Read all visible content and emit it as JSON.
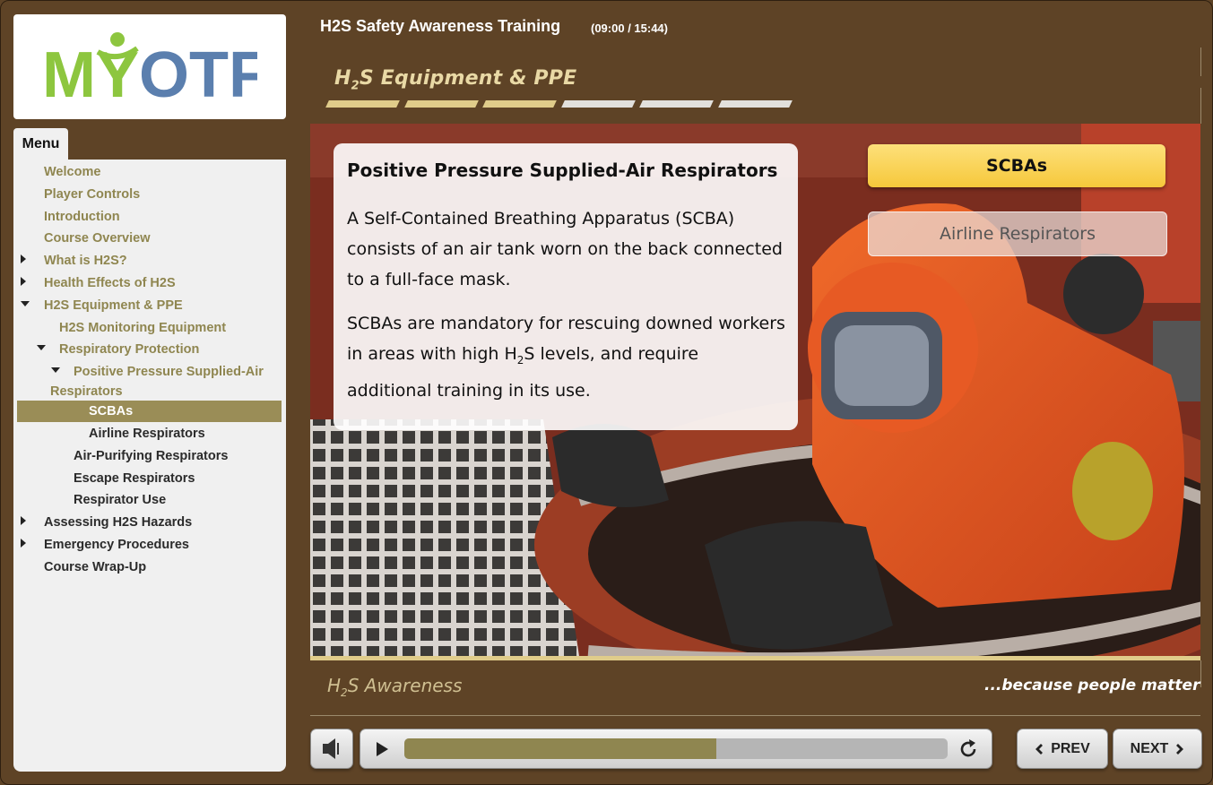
{
  "header": {
    "course_title": "H2S Safety Awareness Training",
    "time": "(09:00 / 15:44)",
    "section_title_prefix": "H",
    "section_title_sub": "2",
    "section_title_rest": "S Equipment & PPE",
    "section_progress": {
      "completed": 3,
      "total": 6
    }
  },
  "logo": {
    "text_my": "MY",
    "text_otf": "OTF",
    "colors": {
      "my": "#8dc63f",
      "otf": "#5b7fae"
    }
  },
  "menu": {
    "tab_label": "Menu",
    "items": [
      {
        "label": "Welcome",
        "state": "done",
        "toggle": "none",
        "indent": 0
      },
      {
        "label": "Player Controls",
        "state": "done",
        "toggle": "none",
        "indent": 0
      },
      {
        "label": "Introduction",
        "state": "done",
        "toggle": "none",
        "indent": 0
      },
      {
        "label": "Course Overview",
        "state": "done",
        "toggle": "none",
        "indent": 0
      },
      {
        "label": "What is H2S?",
        "state": "done",
        "toggle": "collapsed",
        "indent": 0
      },
      {
        "label": "Health Effects of H2S",
        "state": "done",
        "toggle": "collapsed",
        "indent": 0
      },
      {
        "label": "H2S Equipment & PPE",
        "state": "done",
        "toggle": "expanded",
        "indent": 0
      },
      {
        "label": "H2S Monitoring Equipment",
        "state": "done",
        "toggle": "none",
        "indent": 1
      },
      {
        "label": "Respiratory Protection",
        "state": "done",
        "toggle": "expanded",
        "indent": 1
      },
      {
        "label": "Positive Pressure Supplied-Air",
        "label_line2": "Respirators",
        "state": "done",
        "toggle": "expanded",
        "indent": 2
      },
      {
        "label": "SCBAs",
        "state": "selected",
        "toggle": "none",
        "indent": 3
      },
      {
        "label": "Airline Respirators",
        "state": "todo",
        "toggle": "none",
        "indent": 3
      },
      {
        "label": "Air-Purifying Respirators",
        "state": "todo",
        "toggle": "none",
        "indent": 2
      },
      {
        "label": "Escape Respirators",
        "state": "todo",
        "toggle": "none",
        "indent": 2
      },
      {
        "label": "Respirator Use",
        "state": "todo",
        "toggle": "none",
        "indent": 2
      },
      {
        "label": "Assessing H2S Hazards",
        "state": "todo",
        "toggle": "collapsed",
        "indent": 0
      },
      {
        "label": "Emergency Procedures",
        "state": "todo",
        "toggle": "collapsed",
        "indent": 0
      },
      {
        "label": "Course Wrap-Up",
        "state": "todo",
        "toggle": "none",
        "indent": 0
      }
    ]
  },
  "slide": {
    "heading": "Positive Pressure Supplied-Air Respirators",
    "para1": "A Self-Contained Breathing Apparatus (SCBA) consists of an air tank worn on the back connected to a full-face mask.",
    "para2_before": "SCBAs are mandatory for rescuing downed workers in areas with high H",
    "para2_sub": "2",
    "para2_after": "S levels, and require additional training in its use.",
    "tabs": [
      {
        "label": "SCBAs",
        "active": true
      },
      {
        "label": "Airline Respirators",
        "active": false
      }
    ],
    "image_description_icon": "worker-scba-photo"
  },
  "footer": {
    "left_prefix": "H",
    "left_sub": "2",
    "left_rest": "S Awareness",
    "right": "...because people matter"
  },
  "player": {
    "progress_fraction": 0.5747,
    "prev_label": "PREV",
    "next_label": "NEXT"
  },
  "colors": {
    "background": "#5e4326",
    "accent_gold": "#e0cc8a",
    "menu_done": "#8f8650",
    "menu_selected_bg": "#9a8d57",
    "tab_active": "#f8cd45"
  }
}
